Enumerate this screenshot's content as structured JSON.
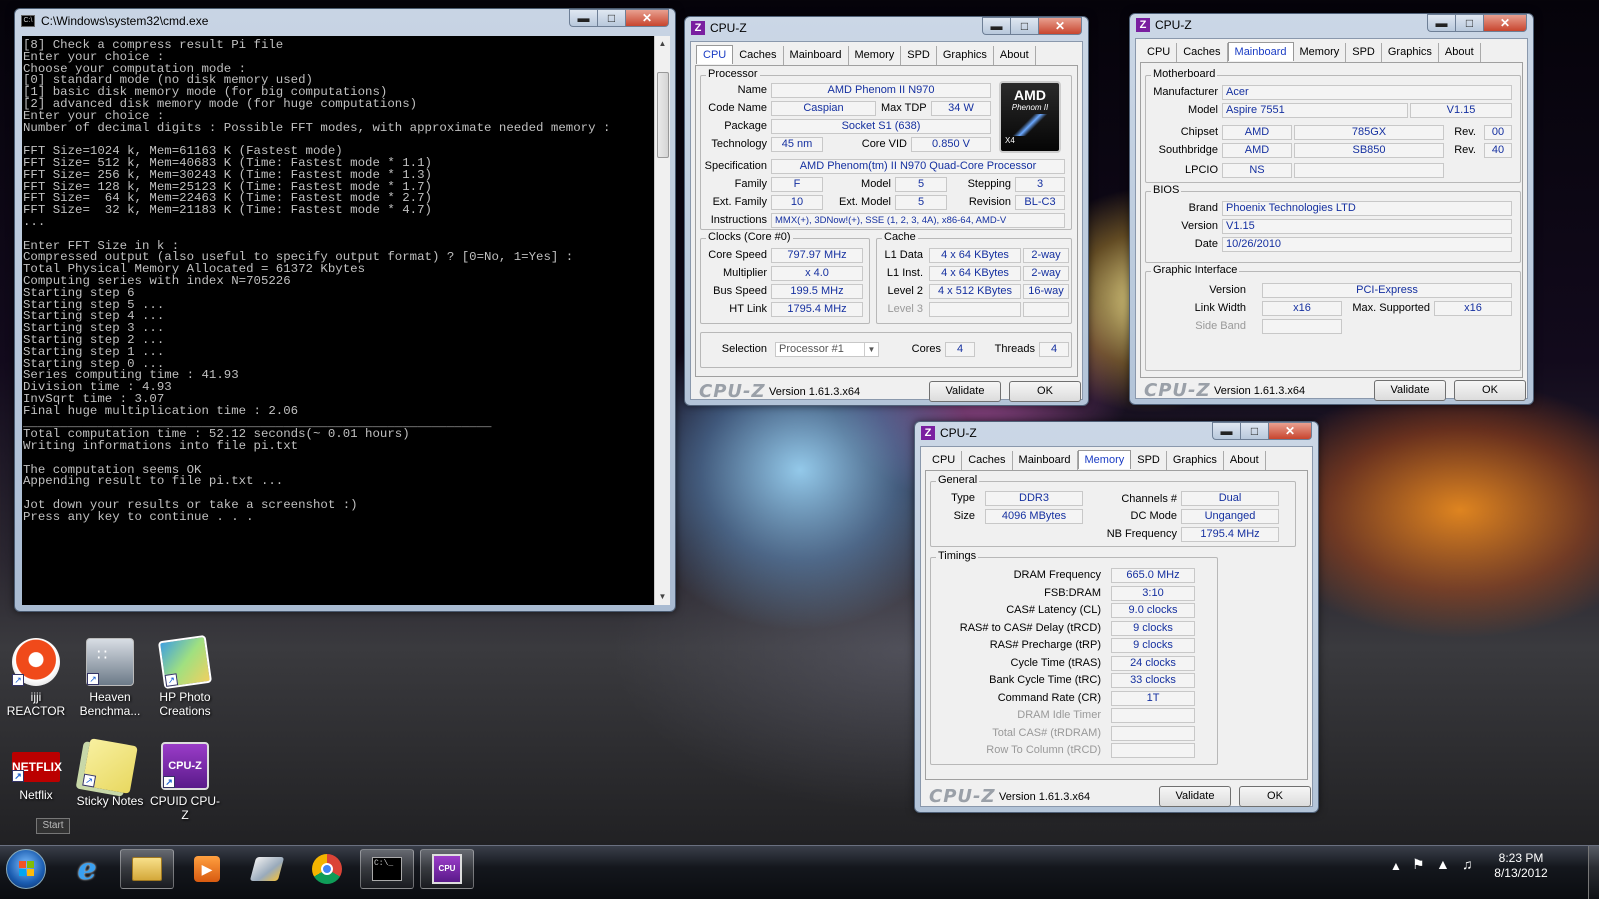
{
  "cmd": {
    "title": "C:\\Windows\\system32\\cmd.exe",
    "lines": [
      "[8] Check a compress result Pi file",
      "Enter your choice :",
      "Choose your computation mode :",
      "[0] standard mode (no disk memory used)",
      "[1] basic disk memory mode (for big computations)",
      "[2] advanced disk memory mode (for huge computations)",
      "Enter your choice :",
      "Number of decimal digits : Possible FFT modes, with approximate needed memory :",
      "",
      "FFT Size=1024 k, Mem=61163 K (Fastest mode)",
      "FFT Size= 512 k, Mem=40683 K (Time: Fastest mode * 1.1)",
      "FFT Size= 256 k, Mem=30243 K (Time: Fastest mode * 1.3)",
      "FFT Size= 128 k, Mem=25123 K (Time: Fastest mode * 1.7)",
      "FFT Size=  64 k, Mem=22463 K (Time: Fastest mode * 2.7)",
      "FFT Size=  32 k, Mem=21183 K (Time: Fastest mode * 4.7)",
      "...",
      "",
      "Enter FFT Size in k :",
      "Compressed output (also useful to specify output format) ? [0=No, 1=Yes] :",
      "Total Physical Memory Allocated = 61372 Kbytes",
      "Computing series with index N=705226",
      "Starting step 6",
      "Starting step 5 ...",
      "Starting step 4 ...",
      "Starting step 3 ...",
      "Starting step 2 ...",
      "Starting step 1 ...",
      "Starting step 0 ...",
      "Series computing time : 41.93",
      "Division time : 4.93",
      "InvSqrt time : 3.07",
      "Final huge multiplication time : 2.06",
      "_______________________________________________________________",
      "Total computation time : 52.12 seconds(~ 0.01 hours)",
      "Writing informations into file pi.txt",
      "",
      "The computation seems OK",
      "Appending result to file pi.txt ...",
      "",
      "Jot down your results or take a screenshot :)",
      "Press any key to continue . . ."
    ]
  },
  "common": {
    "app_title": "CPU-Z",
    "version": "Version 1.61.3.x64",
    "validate": "Validate",
    "ok": "OK",
    "logo": "CPU-Z",
    "tabs": [
      "CPU",
      "Caches",
      "Mainboard",
      "Memory",
      "SPD",
      "Graphics",
      "About"
    ]
  },
  "cpu": {
    "processor_group": "Processor",
    "name_label": "Name",
    "name": "AMD Phenom II N970",
    "codename_label": "Code Name",
    "codename": "Caspian",
    "maxtdp_label": "Max TDP",
    "maxtdp": "34 W",
    "package_label": "Package",
    "package": "Socket S1 (638)",
    "tech_label": "Technology",
    "tech": "45 nm",
    "corevid_label": "Core VID",
    "corevid": "0.850 V",
    "spec_label": "Specification",
    "spec": "AMD Phenom(tm) II N970 Quad-Core Processor",
    "family_label": "Family",
    "family": "F",
    "model_label": "Model",
    "model": "5",
    "stepping_label": "Stepping",
    "stepping": "3",
    "extfamily_label": "Ext. Family",
    "extfamily": "10",
    "extmodel_label": "Ext. Model",
    "extmodel": "5",
    "revision_label": "Revision",
    "revision": "BL-C3",
    "instr_label": "Instructions",
    "instr": "MMX(+), 3DNow!(+), SSE (1, 2, 3, 4A), x86-64, AMD-V",
    "clocks_group": "Clocks (Core #0)",
    "corespeed_label": "Core Speed",
    "corespeed": "797.97 MHz",
    "mult_label": "Multiplier",
    "mult": "x 4.0",
    "bus_label": "Bus Speed",
    "bus": "199.5 MHz",
    "ht_label": "HT Link",
    "ht": "1795.4 MHz",
    "cache_group": "Cache",
    "l1d_label": "L1 Data",
    "l1d": "4 x 64 KBytes",
    "l1d_way": "2-way",
    "l1i_label": "L1 Inst.",
    "l1i": "4 x 64 KBytes",
    "l1i_way": "2-way",
    "l2_label": "Level 2",
    "l2": "4 x 512 KBytes",
    "l2_way": "16-way",
    "l3_label": "Level 3",
    "selection_label": "Selection",
    "selection": "Processor #1",
    "cores_label": "Cores",
    "cores": "4",
    "threads_label": "Threads",
    "threads": "4",
    "logo_brand": "AMD",
    "logo_model": "Phenom II",
    "logo_cores": "X4"
  },
  "mb": {
    "mb_group": "Motherboard",
    "manu_label": "Manufacturer",
    "manu": "Acer",
    "model_label": "Model",
    "model": "Aspire 7551",
    "model_rev": "V1.15",
    "chipset_label": "Chipset",
    "chipset_vendor": "AMD",
    "chipset": "785GX",
    "chipset_rev_label": "Rev.",
    "chipset_rev": "00",
    "sb_label": "Southbridge",
    "sb_vendor": "AMD",
    "sb": "SB850",
    "sb_rev_label": "Rev.",
    "sb_rev": "40",
    "lpcio_label": "LPCIO",
    "lpcio": "NS",
    "bios_group": "BIOS",
    "brand_label": "Brand",
    "brand": "Phoenix Technologies LTD",
    "version_label": "Version",
    "version": "V1.15",
    "date_label": "Date",
    "date": "10/26/2010",
    "gi_group": "Graphic Interface",
    "giver_label": "Version",
    "giver": "PCI-Express",
    "lw_label": "Link Width",
    "lw": "x16",
    "maxsup_label": "Max. Supported",
    "maxsup": "x16",
    "sideband_label": "Side Band"
  },
  "mem": {
    "gen_group": "General",
    "type_label": "Type",
    "type": "DDR3",
    "size_label": "Size",
    "size": "4096 MBytes",
    "ch_label": "Channels #",
    "ch": "Dual",
    "dc_label": "DC Mode",
    "dc": "Unganged",
    "nb_label": "NB Frequency",
    "nb": "1795.4 MHz",
    "tim_group": "Timings",
    "timings": [
      {
        "label": "DRAM Frequency",
        "value": "665.0 MHz"
      },
      {
        "label": "FSB:DRAM",
        "value": "3:10"
      },
      {
        "label": "CAS# Latency (CL)",
        "value": "9.0 clocks"
      },
      {
        "label": "RAS# to CAS# Delay (tRCD)",
        "value": "9 clocks"
      },
      {
        "label": "RAS# Precharge (tRP)",
        "value": "9 clocks"
      },
      {
        "label": "Cycle Time (tRAS)",
        "value": "24 clocks"
      },
      {
        "label": "Bank Cycle Time (tRC)",
        "value": "33 clocks"
      },
      {
        "label": "Command Rate (CR)",
        "value": "1T"
      },
      {
        "label": "DRAM Idle Timer",
        "value": ""
      },
      {
        "label": "Total CAS# (tRDRAM)",
        "value": ""
      },
      {
        "label": "Row To Column (tRCD)",
        "value": ""
      }
    ]
  },
  "desktop": {
    "icons": [
      {
        "label": "ijji REACTOR",
        "icon": "reactor-icon"
      },
      {
        "label": "Heaven Benchma...",
        "icon": "heaven-icon"
      },
      {
        "label": "HP Photo Creations",
        "icon": "hp-photo-icon"
      },
      {
        "label": "Netflix",
        "icon": "netflix-icon",
        "logo_text": "NETFLIX"
      },
      {
        "label": "Sticky Notes",
        "icon": "sticky-notes-icon"
      },
      {
        "label": "CPUID CPU-Z",
        "icon": "cpuz-icon",
        "logo_text": "CPU-Z"
      }
    ],
    "start_tooltip": "Start"
  },
  "taskbar": {
    "items": [
      "start-orb",
      "internet-explorer-icon",
      "explorer-icon",
      "media-player-icon",
      "paint-icon",
      "chrome-icon",
      "cmd-icon",
      "cpuz-icon"
    ],
    "time": "8:23 PM",
    "date": "8/13/2012"
  }
}
